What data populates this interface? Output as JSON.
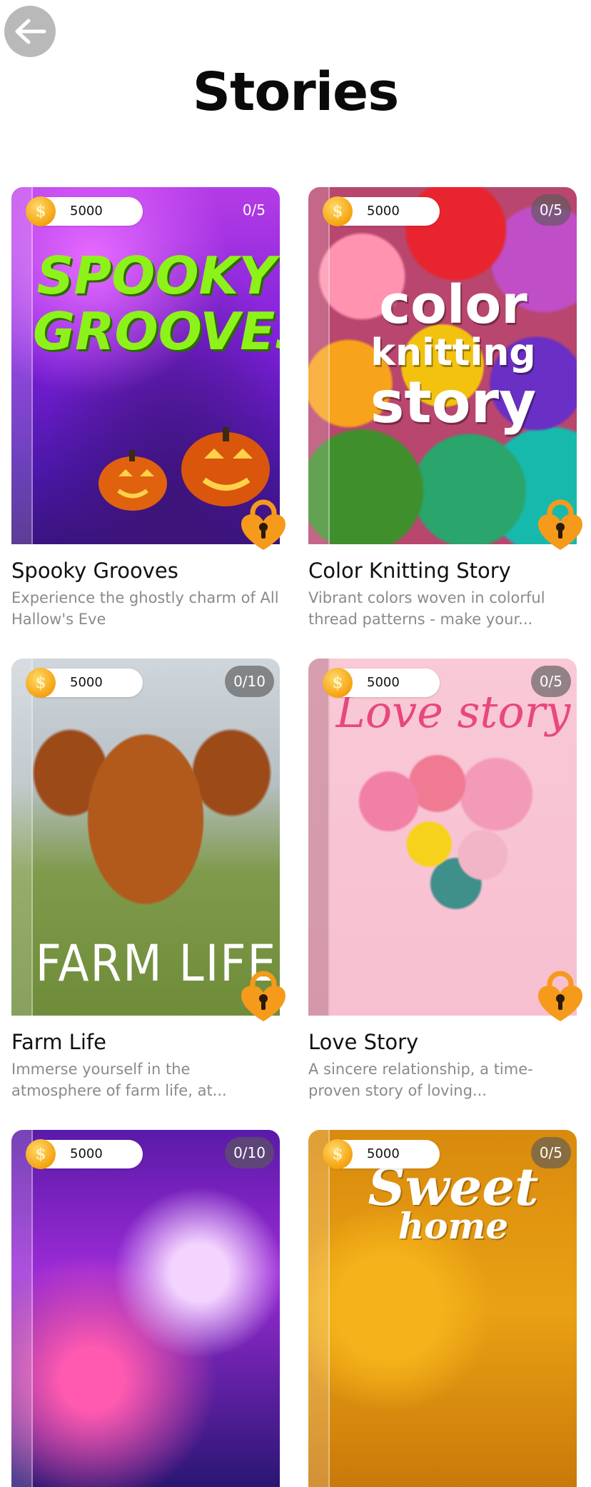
{
  "header": {
    "title": "Stories",
    "back_icon": "arrow-left-icon"
  },
  "colors": {
    "coin": "#f5a20f",
    "lock": "#f59a1b",
    "progress_bg": "#5a5a5a"
  },
  "stories": [
    {
      "coins": "5000",
      "progress": "0/5",
      "cover_text": [
        "SPOOKY",
        "GROOVES"
      ],
      "name": "Spooky Grooves",
      "description": "Experience the ghostly charm of All Hallow's Eve",
      "locked": true
    },
    {
      "coins": "5000",
      "progress": "0/5",
      "cover_text": [
        "color",
        "knitting",
        "story"
      ],
      "name": "Color Knitting Story",
      "description": "Vibrant colors woven in colorful thread patterns - make your...",
      "locked": true
    },
    {
      "coins": "5000",
      "progress": "0/10",
      "cover_text": [
        "FARM LIFE"
      ],
      "name": "Farm Life",
      "description": "Immerse yourself in the atmosphere of farm life, at...",
      "locked": true
    },
    {
      "coins": "5000",
      "progress": "0/5",
      "cover_text": [
        "Love story"
      ],
      "name": "Love Story",
      "description": "A sincere relationship, a time-proven story of loving...",
      "locked": true
    },
    {
      "coins": "5000",
      "progress": "0/10",
      "cover_text": [],
      "name": "",
      "description": "",
      "locked": true
    },
    {
      "coins": "5000",
      "progress": "0/5",
      "cover_text": [
        "Sweet",
        "home"
      ],
      "name": "",
      "description": "",
      "locked": true
    }
  ]
}
